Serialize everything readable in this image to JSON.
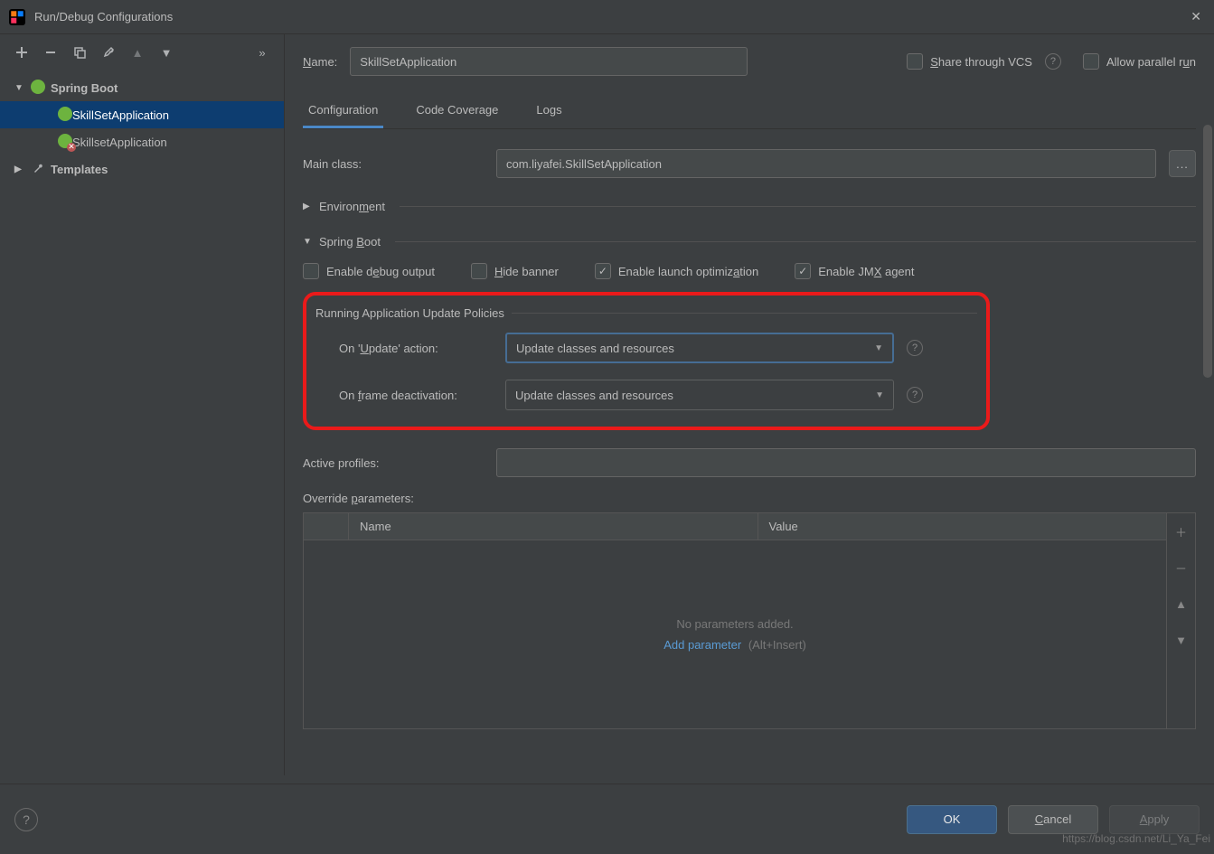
{
  "window": {
    "title": "Run/Debug Configurations"
  },
  "toolbar": {
    "overflow": "»"
  },
  "tree": {
    "spring_boot": "Spring Boot",
    "app1": "SkillSetApplication",
    "app2": "SkillsetApplication",
    "templates": "Templates"
  },
  "header": {
    "name_label": "Name:",
    "name_value": "SkillSetApplication",
    "share_vcs": "Share through VCS",
    "allow_parallel": "Allow parallel run"
  },
  "tabs": {
    "configuration": "Configuration",
    "code_coverage": "Code Coverage",
    "logs": "Logs"
  },
  "form": {
    "main_class_label": "Main class:",
    "main_class_value": "com.liyafei.SkillSetApplication",
    "browse": "...",
    "environment": "Environment",
    "spring_boot": "Spring Boot",
    "enable_debug": "Enable debug output",
    "hide_banner": "Hide banner",
    "enable_launch_opt": "Enable launch optimization",
    "enable_jmx": "Enable JMX agent",
    "running_policies": "Running Application Update Policies",
    "on_update_label": "On 'Update' action:",
    "on_update_value": "Update classes and resources",
    "on_frame_label": "On frame deactivation:",
    "on_frame_value": "Update classes and resources",
    "active_profiles_label": "Active profiles:",
    "active_profiles_value": "",
    "override_params_label": "Override parameters:",
    "col_name": "Name",
    "col_value": "Value",
    "no_params": "No parameters added.",
    "add_param_link": "Add parameter",
    "add_param_hint": "(Alt+Insert)"
  },
  "footer": {
    "ok": "OK",
    "cancel": "Cancel",
    "apply": "Apply"
  },
  "watermark": "https://blog.csdn.net/Li_Ya_Fei"
}
